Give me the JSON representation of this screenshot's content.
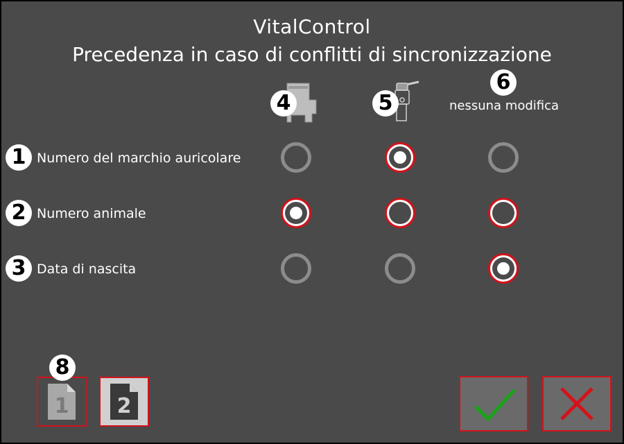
{
  "header": {
    "app_title": "VitalControl",
    "dialog_title": "Precedenza in caso di conflitti di sincronizzazione"
  },
  "columns": [
    {
      "badge": "4",
      "icon": "base-station-icon",
      "label": ""
    },
    {
      "badge": "5",
      "icon": "handheld-reader-icon",
      "label": ""
    },
    {
      "badge": "6",
      "icon": "",
      "label": "nessuna modifica"
    }
  ],
  "rows": [
    {
      "badge": "1",
      "label": "Numero del marchio auricolare",
      "states": [
        "disabled",
        "checked",
        "disabled"
      ]
    },
    {
      "badge": "2",
      "label": "Numero animale",
      "states": [
        "checked",
        "enabled",
        "enabled"
      ]
    },
    {
      "badge": "3",
      "label": "Data di nascita",
      "states": [
        "disabled",
        "disabled",
        "checked"
      ]
    }
  ],
  "pages": {
    "badge": "8",
    "items": [
      {
        "number": "1",
        "active": true
      },
      {
        "number": "2",
        "active": false
      }
    ]
  },
  "actions": {
    "confirm_icon": "check-icon",
    "cancel_icon": "close-icon",
    "confirm_color": "#19a319",
    "cancel_color": "#d3121b"
  },
  "colors": {
    "background": "#4a4a4a",
    "accent": "#d3121b",
    "disabled": "#8c8c8c"
  }
}
